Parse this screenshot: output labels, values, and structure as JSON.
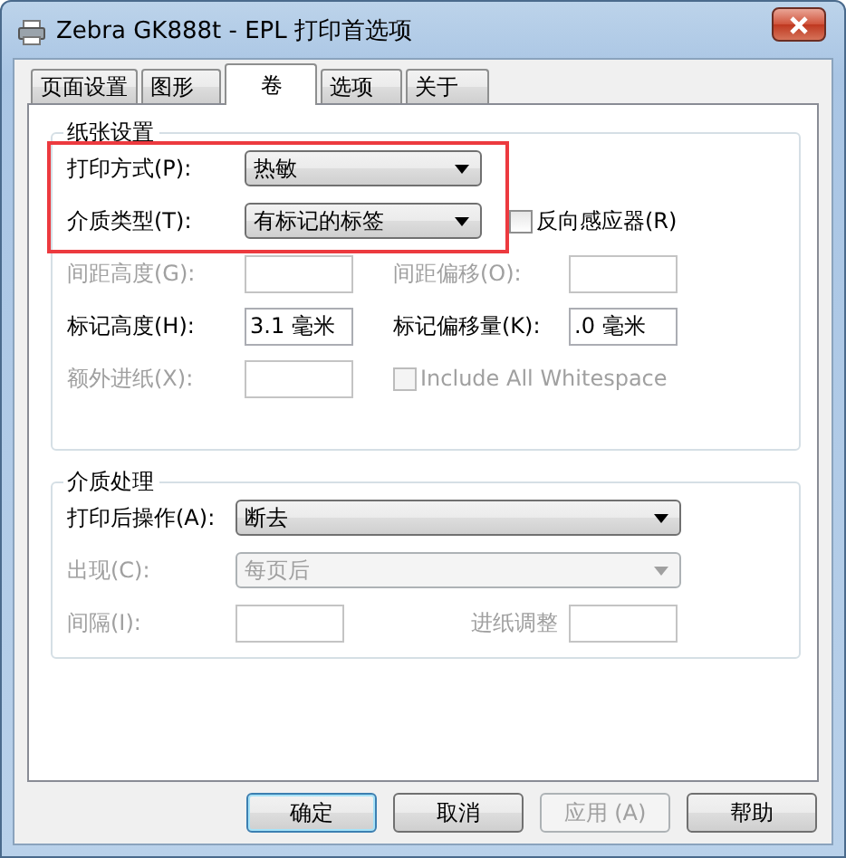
{
  "window": {
    "title": "Zebra GK888t - EPL 打印首选项"
  },
  "tabs": [
    {
      "label": "页面设置",
      "selected": false
    },
    {
      "label": "图形",
      "selected": false
    },
    {
      "label": "卷",
      "selected": true
    },
    {
      "label": "选项",
      "selected": false
    },
    {
      "label": "关于",
      "selected": false
    }
  ],
  "paper_settings": {
    "title": "纸张设置",
    "highlight": {
      "kind": "rectangle",
      "color": "#ec3a3f"
    },
    "rows": [
      {
        "cells": [
          {
            "kind": "select",
            "label": "打印方式(P):",
            "value": "热敏",
            "disabled": false
          }
        ]
      },
      {
        "cells": [
          {
            "kind": "select",
            "label": "介质类型(T):",
            "value": "有标记的标签",
            "disabled": false
          },
          {
            "kind": "checkbox",
            "label": "反向感应器(R)",
            "checked": false,
            "disabled": false
          }
        ]
      },
      {
        "cells": [
          {
            "kind": "text",
            "label": "间距高度(G):",
            "disabled": true
          },
          {
            "kind": "text",
            "label": "间距偏移(O):",
            "disabled": true
          }
        ]
      },
      {
        "cells": [
          {
            "kind": "text",
            "label": "标记高度(H):",
            "value": "3.1 毫米",
            "disabled": false
          },
          {
            "kind": "text",
            "label": "标记偏移量(K):",
            "value": ".0 毫米",
            "disabled": false
          }
        ]
      },
      {
        "cells": [
          {
            "kind": "text",
            "label": "额外进纸(X):",
            "disabled": true
          },
          {
            "kind": "checkbox",
            "label": "Include All Whitespace",
            "checked": false,
            "disabled": true
          }
        ]
      }
    ]
  },
  "media_handling": {
    "title": "介质处理",
    "rows": [
      {
        "cells": [
          {
            "kind": "select",
            "label": "打印后操作(A):",
            "value": "断去",
            "disabled": false
          }
        ]
      },
      {
        "cells": [
          {
            "kind": "select",
            "label": "出现(C):",
            "value": "每页后",
            "disabled": true
          }
        ]
      },
      {
        "cells": [
          {
            "kind": "text",
            "label": "间隔(I):",
            "disabled": true
          },
          {
            "kind": "text",
            "label": "进纸调整",
            "disabled": true
          }
        ]
      }
    ]
  },
  "buttons": [
    {
      "label": "确定",
      "default": true,
      "disabled": false
    },
    {
      "label": "取消",
      "default": false,
      "disabled": false
    },
    {
      "label": "应用 (A)",
      "default": false,
      "disabled": true
    },
    {
      "label": "帮助",
      "default": false,
      "disabled": false
    }
  ]
}
